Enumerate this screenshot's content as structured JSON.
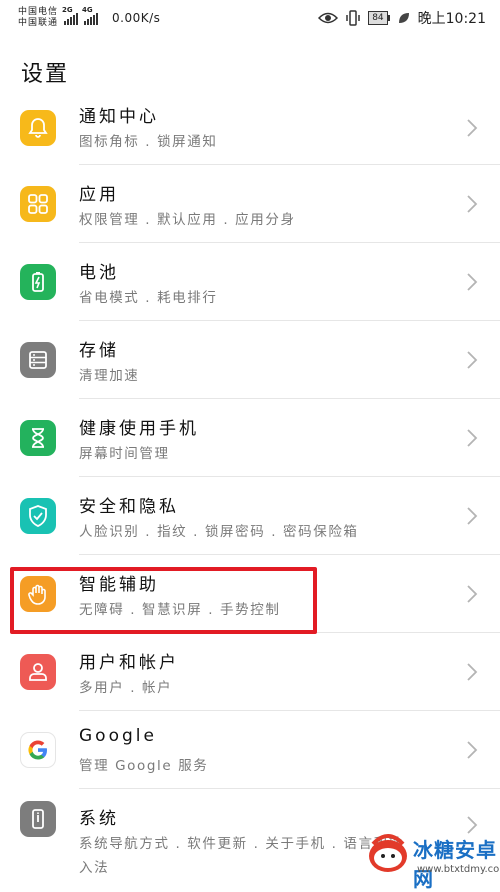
{
  "status_bar": {
    "carrier1": "中国电信",
    "carrier2": "中国联通",
    "net1": "2G",
    "net2": "4G",
    "speed": "0.00K/s",
    "battery": "84",
    "time": "晚上10:21"
  },
  "page": {
    "title": "设置"
  },
  "items": [
    {
      "title": "通知中心",
      "subtitle": "图标角标 . 锁屏通知",
      "icon": "bell-icon",
      "color": "#f7b91a"
    },
    {
      "title": "应用",
      "subtitle": "权限管理 . 默认应用 . 应用分身",
      "icon": "apps-grid-icon",
      "color": "#f6b81b"
    },
    {
      "title": "电池",
      "subtitle": "省电模式 . 耗电排行",
      "icon": "battery-icon",
      "color": "#24b35b"
    },
    {
      "title": "存储",
      "subtitle": "清理加速",
      "icon": "storage-icon",
      "color": "#7d7d7d"
    },
    {
      "title": "健康使用手机",
      "subtitle": "屏幕时间管理",
      "icon": "hourglass-icon",
      "color": "#23b25d"
    },
    {
      "title": "安全和隐私",
      "subtitle": "人脸识别 . 指纹 . 锁屏密码 . 密码保险箱",
      "icon": "shield-icon",
      "color": "#19c2b3"
    },
    {
      "title": "智能辅助",
      "subtitle": "无障碍 . 智慧识屏 . 手势控制",
      "icon": "hand-icon",
      "color": "#f59d25"
    },
    {
      "title": "用户和帐户",
      "subtitle": "多用户 . 帐户",
      "icon": "user-icon",
      "color": "#ee5a55"
    },
    {
      "title": "Google",
      "subtitle": "管理 Google 服务",
      "icon": "google-icon",
      "color": "#ffffff"
    },
    {
      "title": "系统",
      "subtitle": "系统导航方式 . 软件更新 . 关于手机 . 语言和输",
      "subtitle2": "入法",
      "icon": "system-icon",
      "color": "#7d7d7d"
    }
  ],
  "watermark": {
    "text": "冰糖安卓网",
    "url": "www.btxtdmy.com"
  }
}
